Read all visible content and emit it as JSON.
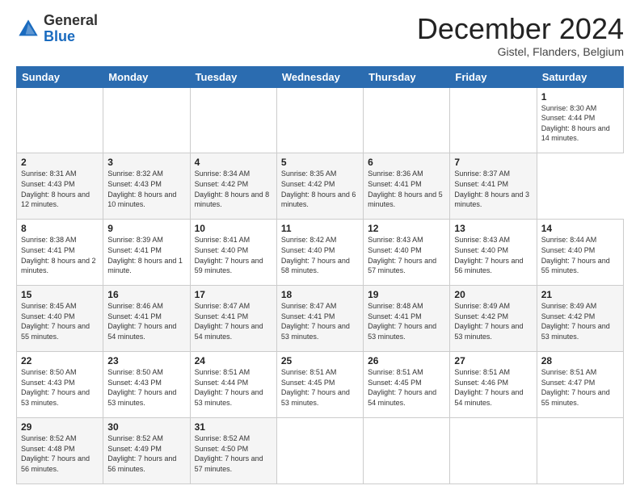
{
  "header": {
    "logo_general": "General",
    "logo_blue": "Blue",
    "month_title": "December 2024",
    "subtitle": "Gistel, Flanders, Belgium"
  },
  "calendar": {
    "days_of_week": [
      "Sunday",
      "Monday",
      "Tuesday",
      "Wednesday",
      "Thursday",
      "Friday",
      "Saturday"
    ],
    "weeks": [
      [
        null,
        null,
        null,
        null,
        null,
        null,
        {
          "num": "1",
          "sunrise": "Sunrise: 8:30 AM",
          "sunset": "Sunset: 4:44 PM",
          "daylight": "Daylight: 8 hours and 14 minutes."
        }
      ],
      [
        {
          "num": "2",
          "sunrise": "Sunrise: 8:31 AM",
          "sunset": "Sunset: 4:43 PM",
          "daylight": "Daylight: 8 hours and 12 minutes."
        },
        {
          "num": "3",
          "sunrise": "Sunrise: 8:32 AM",
          "sunset": "Sunset: 4:43 PM",
          "daylight": "Daylight: 8 hours and 10 minutes."
        },
        {
          "num": "4",
          "sunrise": "Sunrise: 8:34 AM",
          "sunset": "Sunset: 4:42 PM",
          "daylight": "Daylight: 8 hours and 8 minutes."
        },
        {
          "num": "5",
          "sunrise": "Sunrise: 8:35 AM",
          "sunset": "Sunset: 4:42 PM",
          "daylight": "Daylight: 8 hours and 6 minutes."
        },
        {
          "num": "6",
          "sunrise": "Sunrise: 8:36 AM",
          "sunset": "Sunset: 4:41 PM",
          "daylight": "Daylight: 8 hours and 5 minutes."
        },
        {
          "num": "7",
          "sunrise": "Sunrise: 8:37 AM",
          "sunset": "Sunset: 4:41 PM",
          "daylight": "Daylight: 8 hours and 3 minutes."
        }
      ],
      [
        {
          "num": "8",
          "sunrise": "Sunrise: 8:38 AM",
          "sunset": "Sunset: 4:41 PM",
          "daylight": "Daylight: 8 hours and 2 minutes."
        },
        {
          "num": "9",
          "sunrise": "Sunrise: 8:39 AM",
          "sunset": "Sunset: 4:41 PM",
          "daylight": "Daylight: 8 hours and 1 minute."
        },
        {
          "num": "10",
          "sunrise": "Sunrise: 8:41 AM",
          "sunset": "Sunset: 4:40 PM",
          "daylight": "Daylight: 7 hours and 59 minutes."
        },
        {
          "num": "11",
          "sunrise": "Sunrise: 8:42 AM",
          "sunset": "Sunset: 4:40 PM",
          "daylight": "Daylight: 7 hours and 58 minutes."
        },
        {
          "num": "12",
          "sunrise": "Sunrise: 8:43 AM",
          "sunset": "Sunset: 4:40 PM",
          "daylight": "Daylight: 7 hours and 57 minutes."
        },
        {
          "num": "13",
          "sunrise": "Sunrise: 8:43 AM",
          "sunset": "Sunset: 4:40 PM",
          "daylight": "Daylight: 7 hours and 56 minutes."
        },
        {
          "num": "14",
          "sunrise": "Sunrise: 8:44 AM",
          "sunset": "Sunset: 4:40 PM",
          "daylight": "Daylight: 7 hours and 55 minutes."
        }
      ],
      [
        {
          "num": "15",
          "sunrise": "Sunrise: 8:45 AM",
          "sunset": "Sunset: 4:40 PM",
          "daylight": "Daylight: 7 hours and 55 minutes."
        },
        {
          "num": "16",
          "sunrise": "Sunrise: 8:46 AM",
          "sunset": "Sunset: 4:41 PM",
          "daylight": "Daylight: 7 hours and 54 minutes."
        },
        {
          "num": "17",
          "sunrise": "Sunrise: 8:47 AM",
          "sunset": "Sunset: 4:41 PM",
          "daylight": "Daylight: 7 hours and 54 minutes."
        },
        {
          "num": "18",
          "sunrise": "Sunrise: 8:47 AM",
          "sunset": "Sunset: 4:41 PM",
          "daylight": "Daylight: 7 hours and 53 minutes."
        },
        {
          "num": "19",
          "sunrise": "Sunrise: 8:48 AM",
          "sunset": "Sunset: 4:41 PM",
          "daylight": "Daylight: 7 hours and 53 minutes."
        },
        {
          "num": "20",
          "sunrise": "Sunrise: 8:49 AM",
          "sunset": "Sunset: 4:42 PM",
          "daylight": "Daylight: 7 hours and 53 minutes."
        },
        {
          "num": "21",
          "sunrise": "Sunrise: 8:49 AM",
          "sunset": "Sunset: 4:42 PM",
          "daylight": "Daylight: 7 hours and 53 minutes."
        }
      ],
      [
        {
          "num": "22",
          "sunrise": "Sunrise: 8:50 AM",
          "sunset": "Sunset: 4:43 PM",
          "daylight": "Daylight: 7 hours and 53 minutes."
        },
        {
          "num": "23",
          "sunrise": "Sunrise: 8:50 AM",
          "sunset": "Sunset: 4:43 PM",
          "daylight": "Daylight: 7 hours and 53 minutes."
        },
        {
          "num": "24",
          "sunrise": "Sunrise: 8:51 AM",
          "sunset": "Sunset: 4:44 PM",
          "daylight": "Daylight: 7 hours and 53 minutes."
        },
        {
          "num": "25",
          "sunrise": "Sunrise: 8:51 AM",
          "sunset": "Sunset: 4:45 PM",
          "daylight": "Daylight: 7 hours and 53 minutes."
        },
        {
          "num": "26",
          "sunrise": "Sunrise: 8:51 AM",
          "sunset": "Sunset: 4:45 PM",
          "daylight": "Daylight: 7 hours and 54 minutes."
        },
        {
          "num": "27",
          "sunrise": "Sunrise: 8:51 AM",
          "sunset": "Sunset: 4:46 PM",
          "daylight": "Daylight: 7 hours and 54 minutes."
        },
        {
          "num": "28",
          "sunrise": "Sunrise: 8:51 AM",
          "sunset": "Sunset: 4:47 PM",
          "daylight": "Daylight: 7 hours and 55 minutes."
        }
      ],
      [
        {
          "num": "29",
          "sunrise": "Sunrise: 8:52 AM",
          "sunset": "Sunset: 4:48 PM",
          "daylight": "Daylight: 7 hours and 56 minutes."
        },
        {
          "num": "30",
          "sunrise": "Sunrise: 8:52 AM",
          "sunset": "Sunset: 4:49 PM",
          "daylight": "Daylight: 7 hours and 56 minutes."
        },
        {
          "num": "31",
          "sunrise": "Sunrise: 8:52 AM",
          "sunset": "Sunset: 4:50 PM",
          "daylight": "Daylight: 7 hours and 57 minutes."
        },
        null,
        null,
        null,
        null
      ]
    ]
  }
}
